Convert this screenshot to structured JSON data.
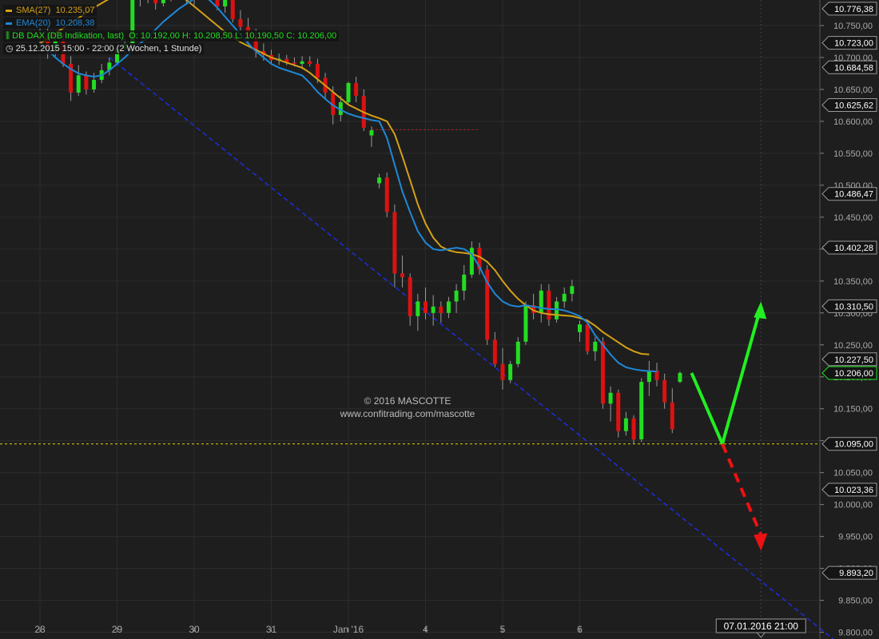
{
  "legend": {
    "sma_label": "SMA(27)",
    "sma_value": "10.235,07",
    "ema_label": "EMA(20)",
    "ema_value": "10.208,38",
    "instrument": "DB DAX (DB Indikation, last)",
    "ohlc": "O: 10.192,00  H: 10.208,50  L: 10.190,50  C: 10.206,00",
    "period": "25.12.2015 15:00 - 22:00 (2 Wochen, 1 Stunde)"
  },
  "watermark": {
    "line1": "© 2016 MASCOTTE",
    "line2": "www.confitrading.com/mascotte"
  },
  "crosshair_time_label": "07.01.2016 21:00",
  "colors": {
    "background": "#1e1e1e",
    "sma": "#d4a017",
    "ema": "#1e88d8",
    "candle_up": "#22dd22",
    "candle_down": "#dd1111",
    "trendline": "#1a2ee0",
    "support": "#e6d200",
    "arrow_up": "#22ee22",
    "arrow_down": "#ee1111"
  },
  "chart_data": {
    "type": "candlestick",
    "ylim": [
      9800,
      10790
    ],
    "y_ticks": [
      {
        "value": 9800,
        "label": "9.800,00"
      },
      {
        "value": 9850,
        "label": "9.850,00"
      },
      {
        "value": 9900,
        "label": "9.900,00"
      },
      {
        "value": 9950,
        "label": "9.950,00"
      },
      {
        "value": 10000,
        "label": "10.000,00"
      },
      {
        "value": 10050,
        "label": "10.050,00"
      },
      {
        "value": 10100,
        "label": "10.100,00"
      },
      {
        "value": 10150,
        "label": "10.150,00"
      },
      {
        "value": 10200,
        "label": "10.200,00"
      },
      {
        "value": 10250,
        "label": "10.250,00"
      },
      {
        "value": 10300,
        "label": "10.300,00"
      },
      {
        "value": 10350,
        "label": "10.350,00"
      },
      {
        "value": 10400,
        "label": "10.400,00"
      },
      {
        "value": 10450,
        "label": "10.450,00"
      },
      {
        "value": 10500,
        "label": "10.500,00"
      },
      {
        "value": 10550,
        "label": "10.550,00"
      },
      {
        "value": 10600,
        "label": "10.600,00"
      },
      {
        "value": 10650,
        "label": "10.650,00"
      },
      {
        "value": 10700,
        "label": "10.700,00"
      },
      {
        "value": 10750,
        "label": "10.750,00"
      }
    ],
    "price_markers": [
      {
        "value": 10776.38,
        "label": "10.776,38",
        "current": false
      },
      {
        "value": 10723.0,
        "label": "10.723,00",
        "current": false
      },
      {
        "value": 10684.58,
        "label": "10.684,58",
        "current": false
      },
      {
        "value": 10625.62,
        "label": "10.625,62",
        "current": false
      },
      {
        "value": 10486.47,
        "label": "10.486,47",
        "current": false
      },
      {
        "value": 10402.28,
        "label": "10.402,28",
        "current": false
      },
      {
        "value": 10310.5,
        "label": "10.310,50",
        "current": false
      },
      {
        "value": 10227.5,
        "label": "10.227,50",
        "current": false
      },
      {
        "value": 10206.0,
        "label": "10.206,00",
        "current": true
      },
      {
        "value": 10095.0,
        "label": "10.095,00",
        "current": false
      },
      {
        "value": 10023.36,
        "label": "10.023,36",
        "current": false
      },
      {
        "value": 9893.2,
        "label": "9.893,20",
        "current": false
      }
    ],
    "x_ticks": [
      {
        "index": 0,
        "label": "28"
      },
      {
        "index": 10,
        "label": "29"
      },
      {
        "index": 20,
        "label": "30"
      },
      {
        "index": 30,
        "label": "31"
      },
      {
        "index": 40,
        "label": "Jan '16"
      },
      {
        "index": 50,
        "label": "4"
      },
      {
        "index": 60,
        "label": "5"
      },
      {
        "index": 70,
        "label": "6"
      }
    ],
    "candles": [
      {
        "o": 10735,
        "h": 10760,
        "l": 10715,
        "c": 10730
      },
      {
        "o": 10730,
        "h": 10752,
        "l": 10698,
        "c": 10712
      },
      {
        "o": 10712,
        "h": 10738,
        "l": 10702,
        "c": 10725
      },
      {
        "o": 10725,
        "h": 10738,
        "l": 10685,
        "c": 10690
      },
      {
        "o": 10690,
        "h": 10702,
        "l": 10632,
        "c": 10645
      },
      {
        "o": 10645,
        "h": 10688,
        "l": 10640,
        "c": 10672
      },
      {
        "o": 10672,
        "h": 10678,
        "l": 10642,
        "c": 10650
      },
      {
        "o": 10650,
        "h": 10676,
        "l": 10645,
        "c": 10665
      },
      {
        "o": 10665,
        "h": 10690,
        "l": 10660,
        "c": 10680
      },
      {
        "o": 10680,
        "h": 10700,
        "l": 10672,
        "c": 10692
      },
      {
        "o": 10692,
        "h": 10720,
        "l": 10688,
        "c": 10714
      },
      {
        "o": 10714,
        "h": 10730,
        "l": 10705,
        "c": 10722
      },
      {
        "o": 10722,
        "h": 10800,
        "l": 10718,
        "c": 10795
      },
      {
        "o": 10795,
        "h": 10810,
        "l": 10780,
        "c": 10800
      },
      {
        "o": 10800,
        "h": 10815,
        "l": 10785,
        "c": 10792
      },
      {
        "o": 10792,
        "h": 10808,
        "l": 10775,
        "c": 10785
      },
      {
        "o": 10785,
        "h": 10805,
        "l": 10780,
        "c": 10798
      },
      {
        "o": 10798,
        "h": 10810,
        "l": 10788,
        "c": 10804
      },
      {
        "o": 10804,
        "h": 10812,
        "l": 10790,
        "c": 10800
      },
      {
        "o": 10800,
        "h": 10808,
        "l": 10785,
        "c": 10790
      },
      {
        "o": 10790,
        "h": 10806,
        "l": 10782,
        "c": 10800
      },
      {
        "o": 10800,
        "h": 10812,
        "l": 10790,
        "c": 10805
      },
      {
        "o": 10805,
        "h": 10812,
        "l": 10788,
        "c": 10795
      },
      {
        "o": 10795,
        "h": 10808,
        "l": 10774,
        "c": 10780
      },
      {
        "o": 10780,
        "h": 10800,
        "l": 10770,
        "c": 10795
      },
      {
        "o": 10795,
        "h": 10802,
        "l": 10755,
        "c": 10760
      },
      {
        "o": 10760,
        "h": 10774,
        "l": 10742,
        "c": 10748
      },
      {
        "o": 10748,
        "h": 10762,
        "l": 10720,
        "c": 10730
      },
      {
        "o": 10730,
        "h": 10745,
        "l": 10700,
        "c": 10710
      },
      {
        "o": 10710,
        "h": 10722,
        "l": 10695,
        "c": 10704
      },
      {
        "o": 10704,
        "h": 10712,
        "l": 10690,
        "c": 10696
      },
      {
        "o": 10696,
        "h": 10706,
        "l": 10688,
        "c": 10698
      },
      {
        "o": 10698,
        "h": 10704,
        "l": 10688,
        "c": 10692
      },
      {
        "o": 10692,
        "h": 10700,
        "l": 10686,
        "c": 10690
      },
      {
        "o": 10690,
        "h": 10702,
        "l": 10682,
        "c": 10694
      },
      {
        "o": 10694,
        "h": 10702,
        "l": 10686,
        "c": 10690
      },
      {
        "o": 10690,
        "h": 10698,
        "l": 10660,
        "c": 10668
      },
      {
        "o": 10668,
        "h": 10676,
        "l": 10636,
        "c": 10645
      },
      {
        "o": 10645,
        "h": 10655,
        "l": 10595,
        "c": 10610
      },
      {
        "o": 10610,
        "h": 10640,
        "l": 10600,
        "c": 10630
      },
      {
        "o": 10630,
        "h": 10662,
        "l": 10625,
        "c": 10660
      },
      {
        "o": 10660,
        "h": 10670,
        "l": 10630,
        "c": 10640
      },
      {
        "o": 10640,
        "h": 10650,
        "l": 10585,
        "c": 10590
      },
      {
        "o": 10578,
        "h": 10592,
        "l": 10560,
        "c": 10586
      },
      {
        "o": 10503,
        "h": 10518,
        "l": 10495,
        "c": 10512
      },
      {
        "o": 10512,
        "h": 10520,
        "l": 10450,
        "c": 10458
      },
      {
        "o": 10458,
        "h": 10470,
        "l": 10340,
        "c": 10362
      },
      {
        "o": 10362,
        "h": 10390,
        "l": 10340,
        "c": 10356
      },
      {
        "o": 10356,
        "h": 10362,
        "l": 10280,
        "c": 10295
      },
      {
        "o": 10295,
        "h": 10330,
        "l": 10272,
        "c": 10318
      },
      {
        "o": 10318,
        "h": 10340,
        "l": 10290,
        "c": 10300
      },
      {
        "o": 10300,
        "h": 10328,
        "l": 10280,
        "c": 10310
      },
      {
        "o": 10310,
        "h": 10318,
        "l": 10285,
        "c": 10300
      },
      {
        "o": 10300,
        "h": 10325,
        "l": 10292,
        "c": 10318
      },
      {
        "o": 10318,
        "h": 10345,
        "l": 10300,
        "c": 10335
      },
      {
        "o": 10335,
        "h": 10375,
        "l": 10320,
        "c": 10360
      },
      {
        "o": 10360,
        "h": 10412,
        "l": 10355,
        "c": 10402
      },
      {
        "o": 10402,
        "h": 10410,
        "l": 10360,
        "c": 10368
      },
      {
        "o": 10368,
        "h": 10375,
        "l": 10250,
        "c": 10258
      },
      {
        "o": 10258,
        "h": 10270,
        "l": 10215,
        "c": 10220
      },
      {
        "o": 10220,
        "h": 10245,
        "l": 10180,
        "c": 10195
      },
      {
        "o": 10195,
        "h": 10225,
        "l": 10190,
        "c": 10220
      },
      {
        "o": 10220,
        "h": 10262,
        "l": 10215,
        "c": 10255
      },
      {
        "o": 10255,
        "h": 10318,
        "l": 10250,
        "c": 10312
      },
      {
        "o": 10312,
        "h": 10330,
        "l": 10290,
        "c": 10300
      },
      {
        "o": 10300,
        "h": 10345,
        "l": 10285,
        "c": 10335
      },
      {
        "o": 10335,
        "h": 10345,
        "l": 10280,
        "c": 10290
      },
      {
        "o": 10290,
        "h": 10325,
        "l": 10285,
        "c": 10318
      },
      {
        "o": 10318,
        "h": 10340,
        "l": 10308,
        "c": 10330
      },
      {
        "o": 10330,
        "h": 10352,
        "l": 10318,
        "c": 10342
      },
      {
        "o": 10270,
        "h": 10288,
        "l": 10255,
        "c": 10282
      },
      {
        "o": 10282,
        "h": 10290,
        "l": 10235,
        "c": 10240
      },
      {
        "o": 10240,
        "h": 10262,
        "l": 10225,
        "c": 10255
      },
      {
        "o": 10255,
        "h": 10262,
        "l": 10150,
        "c": 10158
      },
      {
        "o": 10158,
        "h": 10185,
        "l": 10130,
        "c": 10175
      },
      {
        "o": 10175,
        "h": 10180,
        "l": 10105,
        "c": 10115
      },
      {
        "o": 10115,
        "h": 10145,
        "l": 10108,
        "c": 10135
      },
      {
        "o": 10135,
        "h": 10140,
        "l": 10095,
        "c": 10102
      },
      {
        "o": 10102,
        "h": 10198,
        "l": 10098,
        "c": 10192
      },
      {
        "o": 10192,
        "h": 10225,
        "l": 10170,
        "c": 10210
      },
      {
        "o": 10210,
        "h": 10222,
        "l": 10185,
        "c": 10195
      },
      {
        "o": 10195,
        "h": 10205,
        "l": 10150,
        "c": 10160
      },
      {
        "o": 10160,
        "h": 10182,
        "l": 10112,
        "c": 10118
      },
      {
        "o": 10192,
        "h": 10208.5,
        "l": 10190.5,
        "c": 10206
      }
    ],
    "series": [
      {
        "name": "SMA(27)",
        "start": 0,
        "values": [
          10722,
          10730,
          10738,
          10746,
          10754,
          10762,
          10770,
          10778,
          10785,
          10792,
          10800,
          10805,
          10810,
          10812,
          10813,
          10812,
          10810,
          10805,
          10798,
          10790,
          10780,
          10770,
          10760,
          10750,
          10740,
          10732,
          10724,
          10718,
          10712,
          10706,
          10700,
          10696,
          10692,
          10688,
          10684,
          10676,
          10666,
          10656,
          10646,
          10636,
          10626,
          10620,
          10614,
          10609,
          10605,
          10600,
          10580,
          10545,
          10508,
          10470,
          10440,
          10418,
          10404,
          10398,
          10395,
          10394,
          10392,
          10388,
          10380,
          10367,
          10350,
          10335,
          10322,
          10312,
          10304,
          10300,
          10298,
          10297,
          10296,
          10295,
          10292,
          10288,
          10280,
          10270,
          10262,
          10254,
          10246,
          10240,
          10236,
          10235.07
        ]
      },
      {
        "name": "EMA(20)",
        "start": 0,
        "values": [
          10722,
          10712,
          10700,
          10690,
          10682,
          10675,
          10672,
          10670,
          10672,
          10680,
          10690,
          10700,
          10712,
          10722,
          10732,
          10744,
          10756,
          10766,
          10776,
          10784,
          10792,
          10796,
          10790,
          10778,
          10764,
          10750,
          10736,
          10722,
          10710,
          10700,
          10690,
          10684,
          10680,
          10676,
          10672,
          10660,
          10646,
          10635,
          10625,
          10618,
          10612,
          10608,
          10605,
          10602,
          10600,
          10574,
          10532,
          10490,
          10458,
          10428,
          10410,
          10400,
          10398,
          10400,
          10402,
          10400,
          10392,
          10372,
          10348,
          10330,
          10318,
          10312,
          10310,
          10312,
          10310,
          10308,
          10306,
          10306,
          10304,
          10300,
          10295,
          10285,
          10265,
          10250,
          10235,
          10222,
          10215,
          10212,
          10210,
          10209,
          10208.38
        ]
      }
    ],
    "annotations": {
      "trendline": [
        {
          "i": 9,
          "v": 10700
        },
        {
          "i": 103,
          "v": 9788
        }
      ],
      "support_level": 10095,
      "resistance_dashed": {
        "from": 43,
        "to": 57,
        "v": 10587
      },
      "arrow_up": [
        {
          "i": 84.5,
          "v": 10206
        },
        {
          "i": 88.5,
          "v": 10095
        },
        {
          "i": 93.5,
          "v": 10310.5
        }
      ],
      "arrow_down": [
        {
          "i": 88.5,
          "v": 10095
        },
        {
          "i": 93.5,
          "v": 9935
        }
      ],
      "crosshair_index": 93.5
    }
  }
}
